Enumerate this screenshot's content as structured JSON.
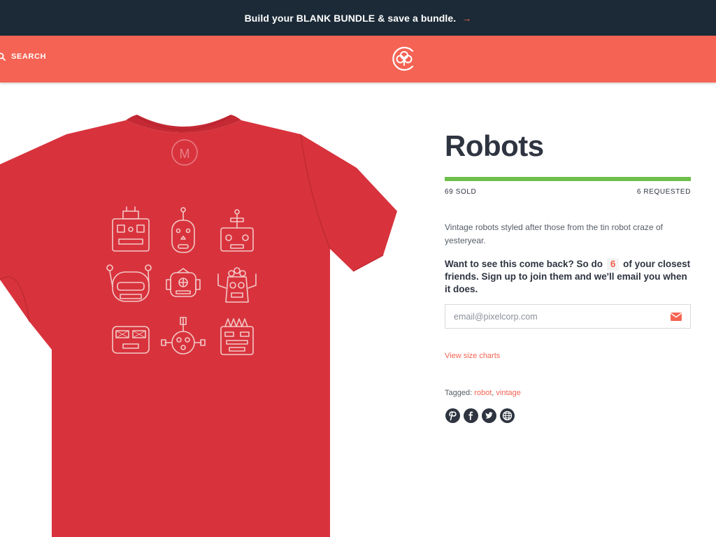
{
  "promo": {
    "prefix": "Build your",
    "highlight": "BLANK BUNDLE",
    "suffix": "& save a bundle.",
    "arrow": "→"
  },
  "header": {
    "search_label": "SEARCH",
    "logo_icon": "cotton-flower-logo-icon"
  },
  "product": {
    "title": "Robots",
    "sold_text": "69 SOLD",
    "requested_text": "6 REQUESTED",
    "progress_fraction": 1.0,
    "description": "Vintage robots styled after those from the tin robot craze of yesteryear.",
    "cta_before": "Want to see this come back? So do",
    "cta_count": "6",
    "cta_after": "of your closest friends. Sign up to join them and we'll email you when it does.",
    "email_placeholder": "email@pixelcorp.com",
    "size_chart_link": "View size charts",
    "tagged_label": "Tagged:",
    "tags": [
      "robot",
      "vintage"
    ],
    "tag_separator": ",",
    "share_icons": [
      "pinterest-icon",
      "facebook-icon",
      "twitter-icon",
      "globe-icon"
    ],
    "shirt_collar_letter": "M"
  },
  "colors": {
    "promo_bg": "#1b2a36",
    "header_bg": "#f46353",
    "accent": "#f46353",
    "progress": "#6cc04a",
    "shirt": "#d8333d",
    "text_dark": "#2e3440"
  }
}
